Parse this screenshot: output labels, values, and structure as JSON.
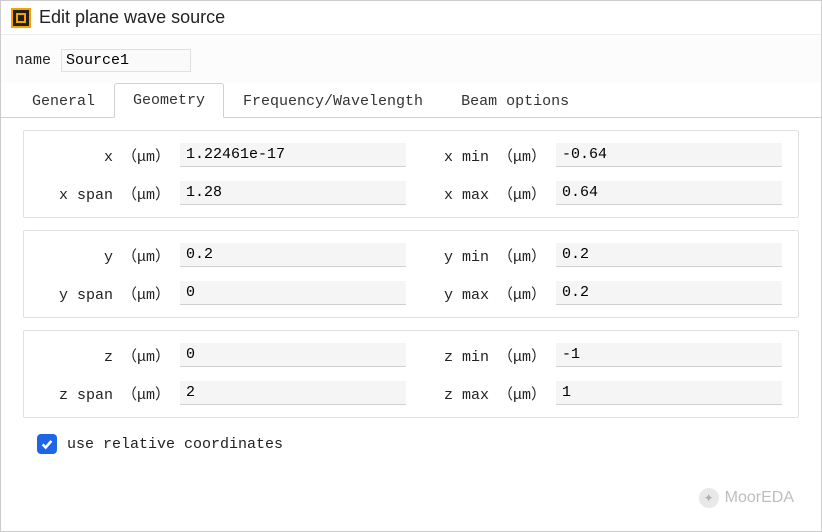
{
  "window": {
    "title": "Edit plane wave source"
  },
  "name_field": {
    "label": "name",
    "value": "Source1"
  },
  "tabs": {
    "items": [
      {
        "label": "General"
      },
      {
        "label": "Geometry"
      },
      {
        "label": "Frequency/Wavelength"
      },
      {
        "label": "Beam options"
      }
    ],
    "active_index": 1
  },
  "geometry": {
    "x": {
      "label": "x （μm）",
      "value": "1.22461e-17"
    },
    "x_span": {
      "label": "x span （μm）",
      "value": "1.28"
    },
    "x_min": {
      "label": "x min （μm）",
      "value": "-0.64"
    },
    "x_max": {
      "label": "x max （μm）",
      "value": "0.64"
    },
    "y": {
      "label": "y （μm）",
      "value": "0.2"
    },
    "y_span": {
      "label": "y span （μm）",
      "value": "0"
    },
    "y_min": {
      "label": "y min （μm）",
      "value": "0.2"
    },
    "y_max": {
      "label": "y max （μm）",
      "value": "0.2"
    },
    "z": {
      "label": "z （μm）",
      "value": "0"
    },
    "z_span": {
      "label": "z span （μm）",
      "value": "2"
    },
    "z_min": {
      "label": "z min （μm）",
      "value": "-1"
    },
    "z_max": {
      "label": "z max （μm）",
      "value": "1"
    }
  },
  "relative_coords": {
    "label": "use relative coordinates",
    "checked": true
  },
  "watermark": {
    "text": "MoorEDA"
  }
}
